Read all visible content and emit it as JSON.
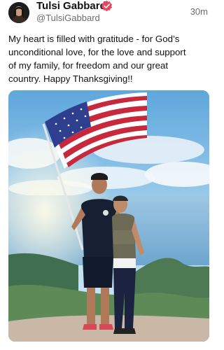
{
  "post": {
    "author": {
      "display_name": "Tulsi Gabbard",
      "handle": "@TulsiGabbard",
      "verified_icon": "verified-badge-icon",
      "avatar_icon": "avatar-photo"
    },
    "timestamp": "30m",
    "text_lines": [
      "My heart is filled with gratitude - for God’s",
      "unconditional love, for the love and support",
      "of my family, for freedom and our great",
      "country. Happy Thanksgiving!!"
    ],
    "media": {
      "kind": "photo",
      "description_icon": "photo-couple-with-us-flag-on-mountain"
    }
  },
  "colors": {
    "verified_badge": "#e8455e",
    "text_primary": "#111111",
    "text_secondary": "#6e6e6e"
  }
}
